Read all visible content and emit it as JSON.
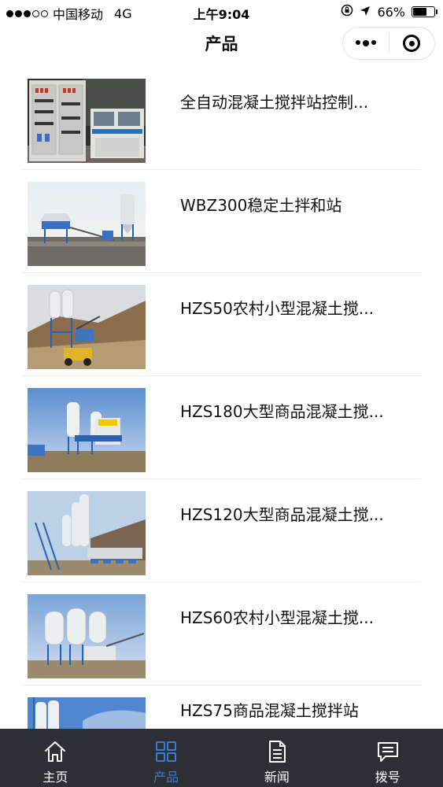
{
  "status_bar": {
    "carrier": "中国移动",
    "network": "4G",
    "time": "上午9:04",
    "battery": "66%",
    "battery_level": 0.66
  },
  "nav": {
    "title": "产品"
  },
  "products": [
    {
      "title": "全自动混凝土搅拌站控制..."
    },
    {
      "title": "WBZ300稳定土拌和站"
    },
    {
      "title": "HZS50农村小型混凝土搅..."
    },
    {
      "title": "HZS180大型商品混凝土搅..."
    },
    {
      "title": "HZS120大型商品混凝土搅..."
    },
    {
      "title": "HZS60农村小型混凝土搅..."
    },
    {
      "title": "HZS75商品混凝土搅拌站"
    }
  ],
  "tabbar": {
    "tabs": [
      {
        "label": "主页",
        "icon": "home-icon"
      },
      {
        "label": "产品",
        "icon": "grid-icon"
      },
      {
        "label": "新闻",
        "icon": "document-icon"
      },
      {
        "label": "拨号",
        "icon": "message-icon"
      }
    ],
    "active_color": "#3a7bd5",
    "background": "#2c3035"
  }
}
